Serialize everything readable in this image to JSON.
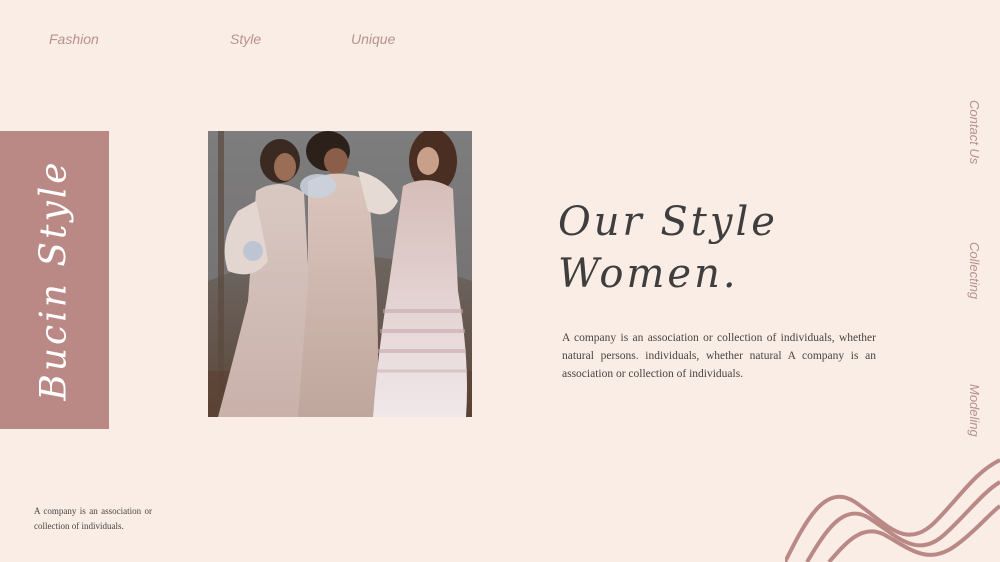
{
  "nav": {
    "items": [
      {
        "label": "Fashion"
      },
      {
        "label": "Style"
      },
      {
        "label": "Unique"
      }
    ]
  },
  "side_nav": {
    "items": [
      {
        "label": "Contact Us"
      },
      {
        "label": "Collecting"
      },
      {
        "label": "Modeling"
      }
    ]
  },
  "brand": {
    "text": "Bucin Style"
  },
  "headline": {
    "line1": "Our Style",
    "line2": "Women."
  },
  "body": {
    "text": "A company is an association or collection of individuals, whether natural persons. individuals, whether natural A company is an association or collection of individuals."
  },
  "footer": {
    "text": "A company is an association or collection of individuals."
  },
  "colors": {
    "background": "#f9ede6",
    "accent": "#bb8985",
    "nav_text": "#b8928c",
    "headline": "#3f3d3d"
  }
}
